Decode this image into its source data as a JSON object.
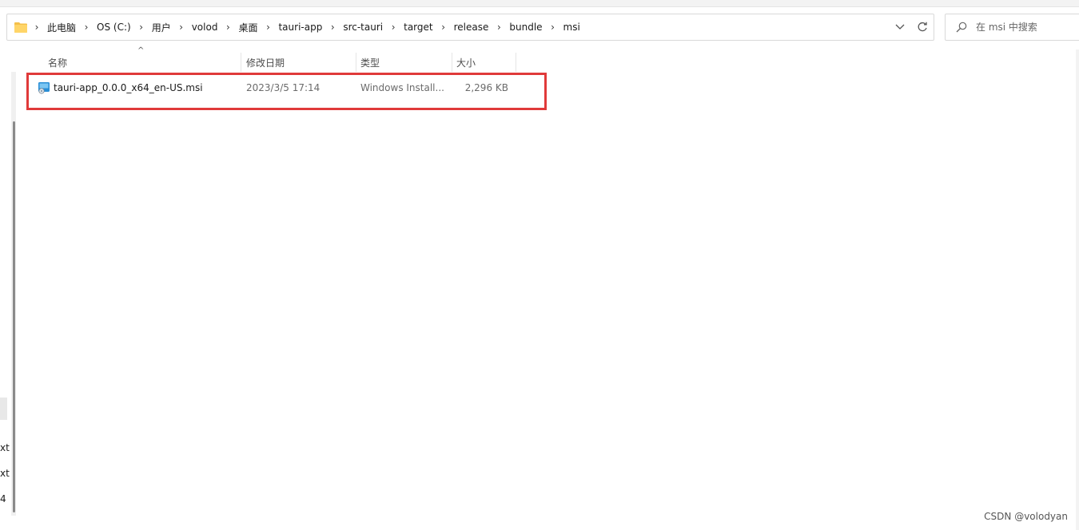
{
  "address_bar": {
    "crumbs": [
      "此电脑",
      "OS (C:)",
      "用户",
      "volod",
      "桌面",
      "tauri-app",
      "src-tauri",
      "target",
      "release",
      "bundle",
      "msi"
    ]
  },
  "search": {
    "placeholder": "在 msi 中搜索"
  },
  "columns": {
    "name": "名称",
    "date": "修改日期",
    "type": "类型",
    "size": "大小"
  },
  "files": [
    {
      "name": "tauri-app_0.0.0_x64_en-US.msi",
      "date": "2023/3/5 17:14",
      "type": "Windows Install...",
      "size": "2,296 KB"
    }
  ],
  "left_pane": {
    "partial_labels": [
      "xt",
      "xt",
      "4"
    ]
  },
  "watermark": "CSDN @volodyan",
  "colors": {
    "highlight": "#e03a3a",
    "folder": "#f5c04a",
    "msi_icon": "#2a8fd6"
  },
  "icons": {
    "folder": "folder-icon",
    "dropdown": "chevron-down-icon",
    "refresh": "refresh-icon",
    "search": "search-icon",
    "file": "msi-installer-icon",
    "sort": "sort-ascending-icon"
  }
}
